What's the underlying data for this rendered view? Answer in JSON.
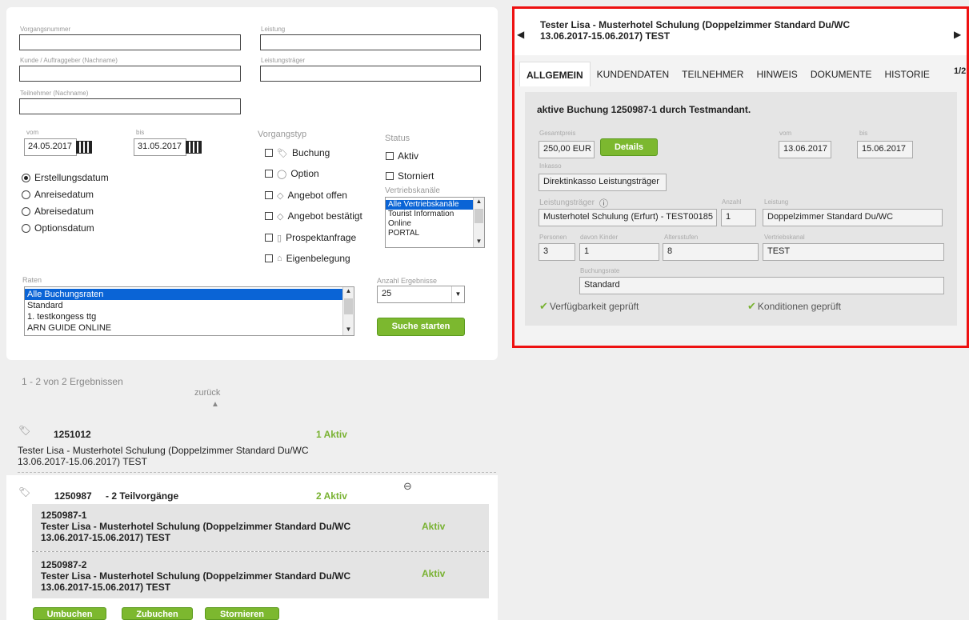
{
  "search": {
    "labels": {
      "vorgangsnummer": "Vorgangsnummer",
      "leistung": "Leistung",
      "kunde": "Kunde / Auftraggeber (Nachname)",
      "leistungstraeger": "Leistungsträger",
      "teilnehmer": "Teilnehmer (Nachname)",
      "vom": "vom",
      "bis": "bis",
      "vorgangstyp": "Vorgangstyp",
      "status": "Status",
      "vertriebskanaele": "Vertriebskanäle",
      "raten": "Raten",
      "anzahl": "Anzahl Ergebnisse"
    },
    "date_from": "24.05.2017",
    "date_to": "31.05.2017",
    "date_types": [
      "Erstellungsdatum",
      "Anreisedatum",
      "Abreisedatum",
      "Optionsdatum"
    ],
    "vorgangstypen": [
      "Buchung",
      "Option",
      "Angebot offen",
      "Angebot bestätigt",
      "Prospektanfrage",
      "Eigenbelegung"
    ],
    "status": [
      "Aktiv",
      "Storniert"
    ],
    "vertriebskanaele": [
      "Alle Vertriebskanäle",
      "Tourist Information",
      "Online",
      "PORTAL"
    ],
    "raten": [
      "Alle Buchungsraten",
      "Standard",
      "1. testkongess ttg",
      "ARN GUIDE ONLINE"
    ],
    "anzahl_value": "25",
    "search_button": "Suche starten"
  },
  "results": {
    "count_text": "1 - 2 von 2 Ergebnissen",
    "back": "zurück",
    "item1": {
      "number": "1251012",
      "status": "1 Aktiv",
      "desc_line1": "Tester Lisa - Musterhotel Schulung (Doppelzimmer Standard Du/WC",
      "desc_line2": "13.06.2017-15.06.2017) TEST"
    },
    "item2": {
      "number": "1250987",
      "sub": "- 2 Teilvorgänge",
      "status": "2 Aktiv",
      "subs": [
        {
          "number": "1250987-1",
          "line1": "Tester Lisa - Musterhotel Schulung (Doppelzimmer Standard Du/WC",
          "line2": "13.06.2017-15.06.2017) TEST",
          "status": "Aktiv"
        },
        {
          "number": "1250987-2",
          "line1": "Tester Lisa - Musterhotel Schulung (Doppelzimmer Standard Du/WC",
          "line2": "13.06.2017-15.06.2017) TEST",
          "status": "Aktiv"
        }
      ]
    },
    "buttons": [
      "Umbuchen",
      "Zubuchen",
      "Stornieren"
    ]
  },
  "detail": {
    "title_line1": "Tester Lisa - Musterhotel Schulung (Doppelzimmer Standard Du/WC",
    "title_line2": "13.06.2017-15.06.2017) TEST",
    "pager": "1/2",
    "tabs": [
      "ALLGEMEIN",
      "KUNDENDATEN",
      "TEILNEHMER",
      "HINWEIS",
      "DOKUMENTE",
      "HISTORIE"
    ],
    "heading": "aktive Buchung 1250987-1 durch Testmandant.",
    "labels": {
      "gesamtpreis": "Gesamtpreis",
      "vom": "vom",
      "bis": "bis",
      "inkasso": "Inkasso",
      "leistungstraeger": "Leistungsträger",
      "anzahl": "Anzahl",
      "leistung": "Leistung",
      "personen": "Personen",
      "kinder": "davon Kinder",
      "altersstufen": "Altersstufen",
      "vertriebskanal": "Vertriebskanal",
      "buchungsrate": "Buchungsrate"
    },
    "price": "250,00 EUR",
    "details_button": "Details",
    "vom": "13.06.2017",
    "bis": "15.06.2017",
    "inkasso": "Direktinkasso Leistungsträger",
    "leistungstraeger": "Musterhotel Schulung (Erfurt) - TEST00185",
    "anzahl": "1",
    "leistung": "Doppelzimmer Standard Du/WC",
    "personen": "3",
    "kinder": "1",
    "altersstufen": "8",
    "vertriebskanal": "TEST",
    "buchungsrate": "Standard",
    "check1": "Verfügbarkeit geprüft",
    "check2": "Konditionen geprüft"
  }
}
